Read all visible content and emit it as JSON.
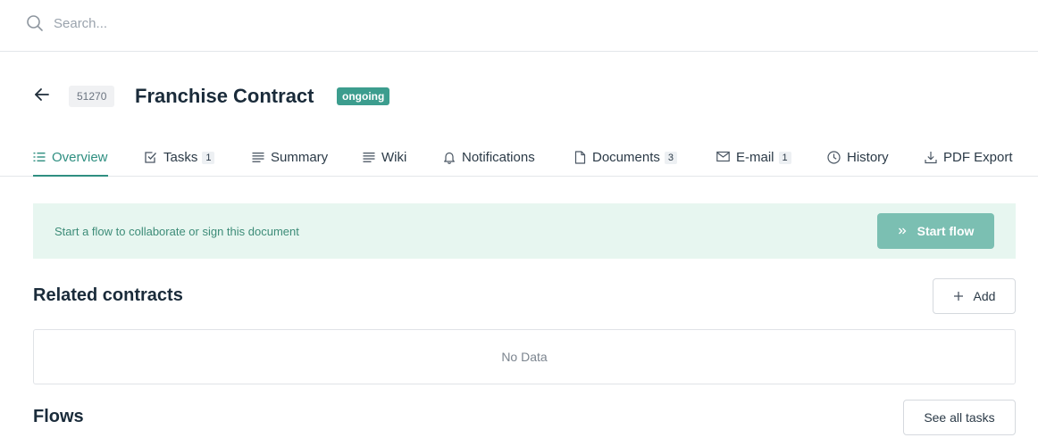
{
  "search": {
    "placeholder": "Search...",
    "icon": "search-icon"
  },
  "header": {
    "id": "51270",
    "title": "Franchise Contract",
    "status": "ongoing",
    "status_color": "#3c9d8e"
  },
  "tabs": [
    {
      "label": "Overview",
      "icon": "list-icon",
      "active": true
    },
    {
      "label": "Tasks",
      "icon": "checkbox-icon",
      "count": "1"
    },
    {
      "label": "Summary",
      "icon": "lines-icon"
    },
    {
      "label": "Wiki",
      "icon": "lines-icon"
    },
    {
      "label": "Notifications",
      "icon": "bell-icon"
    },
    {
      "label": "Documents",
      "icon": "document-icon",
      "count": "3"
    },
    {
      "label": "E-mail",
      "icon": "mail-icon",
      "count": "1"
    },
    {
      "label": "History",
      "icon": "clock-icon"
    },
    {
      "label": "PDF Export",
      "icon": "download-icon"
    }
  ],
  "flow_banner": {
    "text": "Start a flow to collaborate or sign this document",
    "button_label": "Start flow",
    "background": "#e7f6f0",
    "button_color": "#7bbfb2"
  },
  "related_contracts": {
    "title": "Related contracts",
    "add_label": "Add",
    "empty_text": "No Data"
  },
  "flows": {
    "title": "Flows",
    "see_all_label": "See all tasks"
  },
  "accent_color": "#2f8f81"
}
